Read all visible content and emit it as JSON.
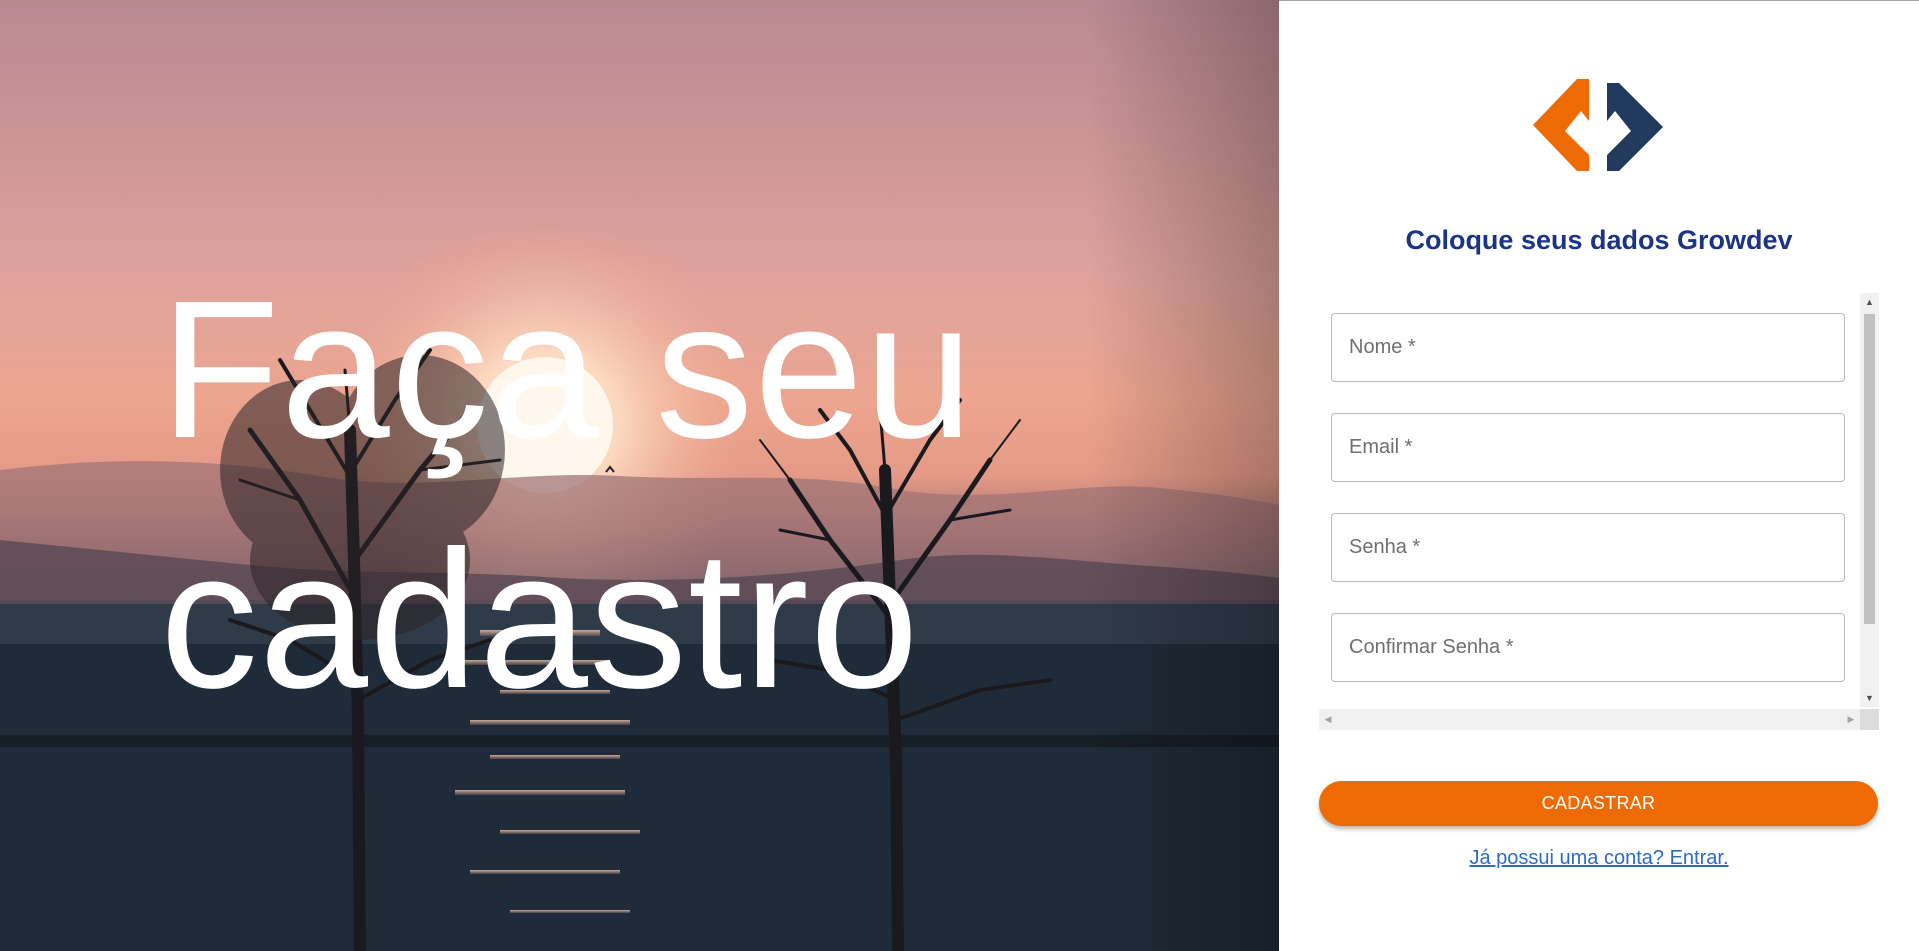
{
  "hero": {
    "title": "Faça seu cadastro",
    "background_description": "sunset-over-lake-with-trees"
  },
  "logo": {
    "icon": "growdev-logo-icon",
    "colors": {
      "orange": "#ee6b04",
      "navy": "#223a5e"
    }
  },
  "form": {
    "title": "Coloque seus dados Growdev",
    "fields": {
      "name": {
        "placeholder": "Nome *",
        "value": ""
      },
      "email": {
        "placeholder": "Email *",
        "value": ""
      },
      "password": {
        "placeholder": "Senha *",
        "value": ""
      },
      "confirm": {
        "placeholder": "Confirmar Senha *",
        "value": ""
      }
    },
    "submit_label": "CADASTRAR",
    "login_link": "Já possui uma conta? Entrar."
  },
  "scrollbars": {
    "up_arrow": "▲",
    "down_arrow": "▼",
    "left_arrow": "◀",
    "right_arrow": "▶"
  },
  "colors": {
    "accent": "#ee6b04",
    "title": "#1b3484",
    "link": "#2b6cc4"
  }
}
